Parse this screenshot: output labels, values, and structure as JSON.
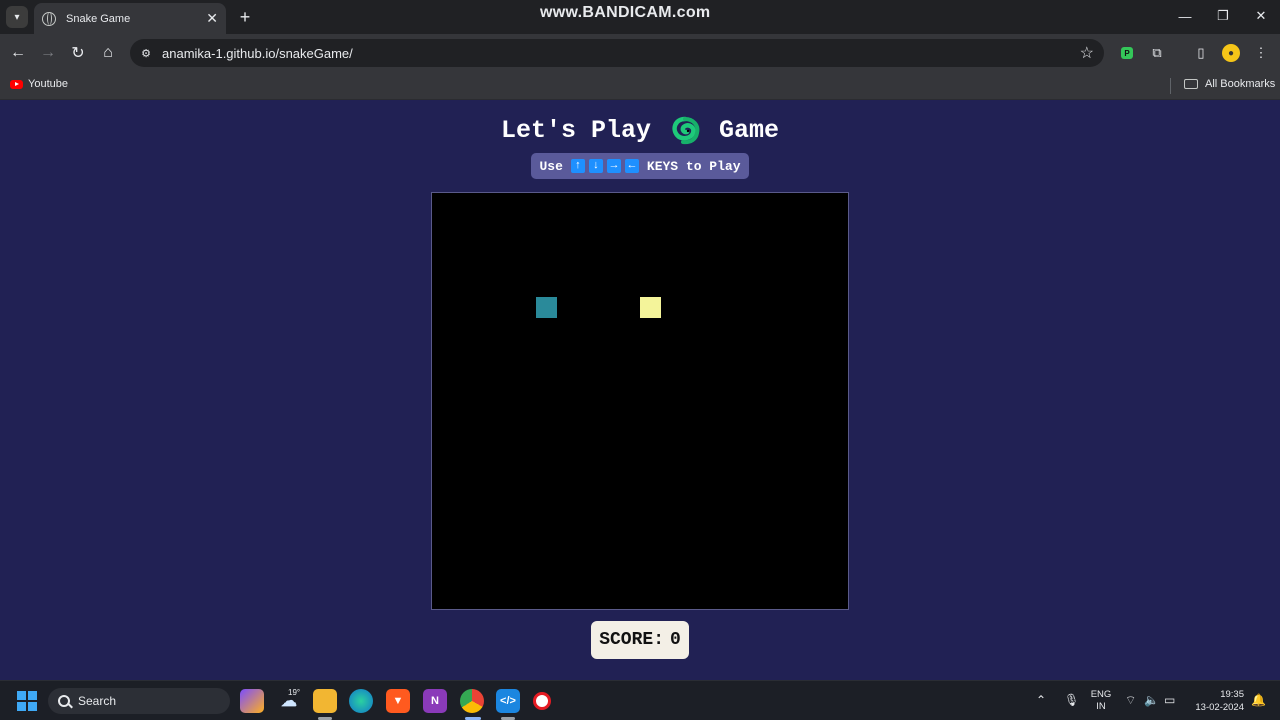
{
  "browser": {
    "watermark": "www.BANDICAM.com",
    "tab": {
      "title": "Snake Game"
    },
    "url": "anamika-1.github.io/snakeGame/",
    "bookmarks": [
      {
        "label": "Youtube"
      }
    ],
    "all_bookmarks_label": "All Bookmarks",
    "extension_badge": "P"
  },
  "game": {
    "heading_left": "Let's Play",
    "heading_right": "Game",
    "heading_icon": "snake-emoji",
    "hint_prefix": "Use",
    "keys": [
      "↑",
      "↓",
      "→",
      "←"
    ],
    "hint_suffix": "KEYS to Play",
    "score_label": "SCORE:",
    "score_value": "0",
    "colors": {
      "page_bg": "#212154",
      "board_bg": "#000000",
      "snake": "#2a8a9a",
      "food": "#f4f49a",
      "hint_bg": "#5a5a9a",
      "key_bg": "#1e90ff"
    }
  },
  "taskbar": {
    "search_placeholder": "Search",
    "weather_temp": "19°",
    "language": "ENG",
    "region": "IN",
    "time": "19:35",
    "date": "13-02-2024"
  }
}
